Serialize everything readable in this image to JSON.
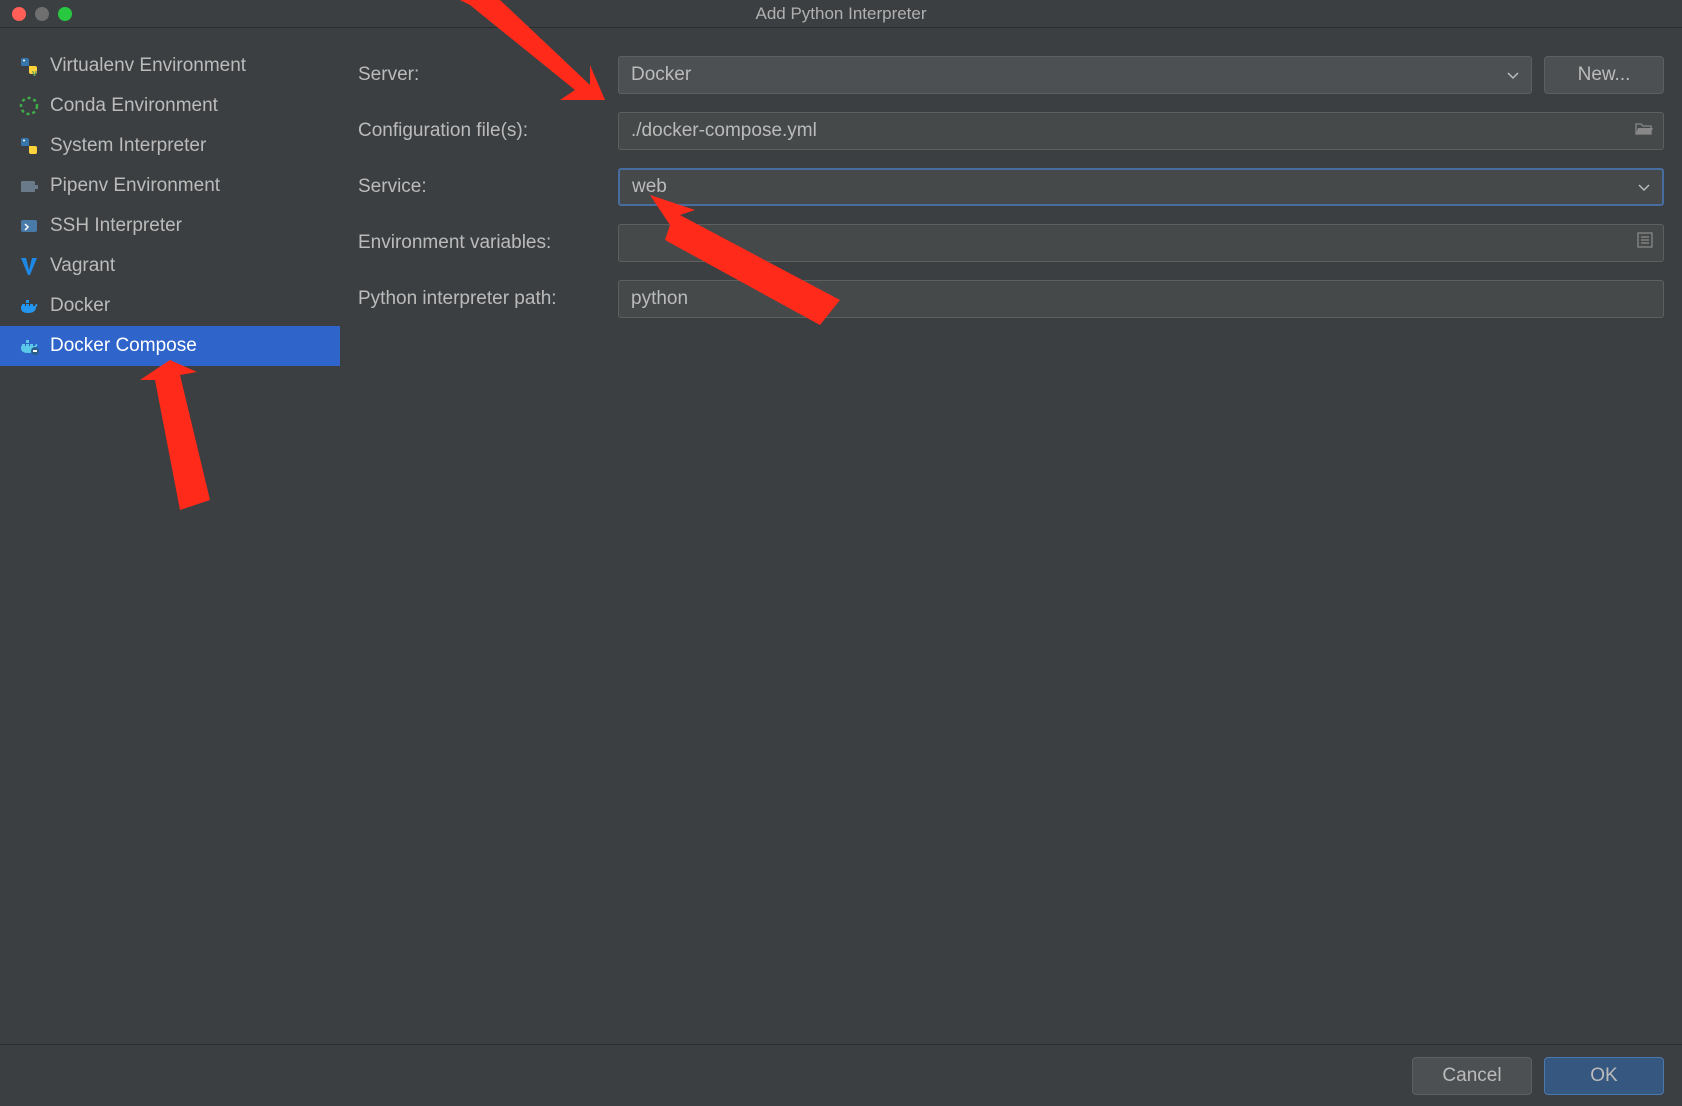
{
  "window": {
    "title": "Add Python Interpreter"
  },
  "sidebar": {
    "items": [
      {
        "label": "Virtualenv Environment",
        "icon": "python-v-icon"
      },
      {
        "label": "Conda Environment",
        "icon": "conda-icon"
      },
      {
        "label": "System Interpreter",
        "icon": "python-icon"
      },
      {
        "label": "Pipenv Environment",
        "icon": "pipenv-icon"
      },
      {
        "label": "SSH Interpreter",
        "icon": "ssh-icon"
      },
      {
        "label": "Vagrant",
        "icon": "vagrant-icon"
      },
      {
        "label": "Docker",
        "icon": "docker-icon"
      },
      {
        "label": "Docker Compose",
        "icon": "docker-compose-icon",
        "selected": true
      }
    ]
  },
  "form": {
    "server_label": "Server:",
    "server_value": "Docker",
    "new_button": "New...",
    "config_label": "Configuration file(s):",
    "config_value": "./docker-compose.yml",
    "service_label": "Service:",
    "service_value": "web",
    "env_label": "Environment variables:",
    "env_value": "",
    "interpreter_label": "Python interpreter path:",
    "interpreter_value": "python"
  },
  "footer": {
    "cancel": "Cancel",
    "ok": "OK"
  }
}
